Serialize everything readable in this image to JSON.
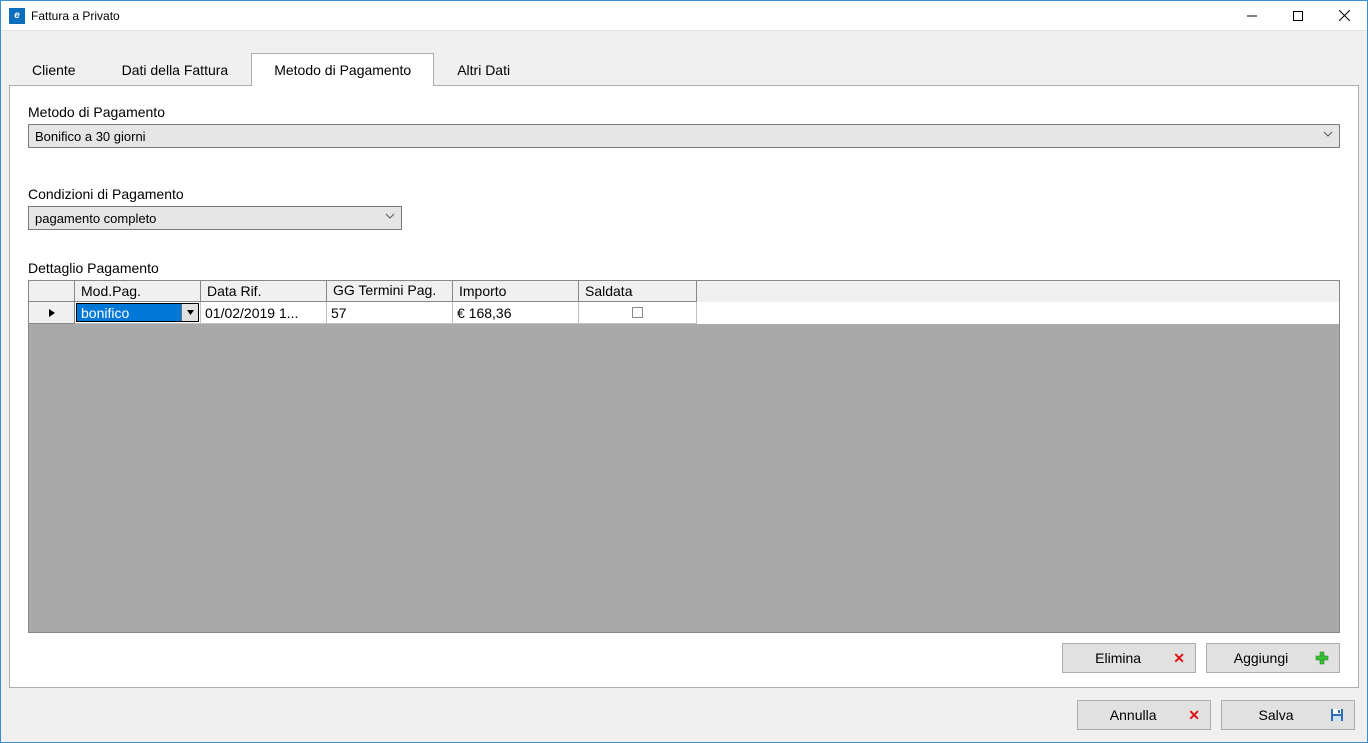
{
  "window": {
    "title": "Fattura a Privato",
    "icon_letter": "e"
  },
  "tabs": [
    {
      "label": "Cliente",
      "active": false
    },
    {
      "label": "Dati della Fattura",
      "active": false
    },
    {
      "label": "Metodo di Pagamento",
      "active": true
    },
    {
      "label": "Altri Dati",
      "active": false
    }
  ],
  "payment_method": {
    "label": "Metodo di Pagamento",
    "value": "Bonifico a 30 giorni"
  },
  "payment_conditions": {
    "label": "Condizioni di Pagamento",
    "value": "pagamento completo"
  },
  "detail": {
    "label": "Dettaglio Pagamento",
    "columns": {
      "mod_pag": "Mod.Pag.",
      "data_rif": "Data Rif.",
      "gg_termini": "GG Termini Pag.",
      "importo": "Importo",
      "saldata": "Saldata"
    },
    "rows": [
      {
        "mod_pag": "bonifico",
        "data_rif": "01/02/2019 1...",
        "gg_termini": "57",
        "importo": "€ 168,36",
        "saldata": false
      }
    ]
  },
  "buttons": {
    "elimina": "Elimina",
    "aggiungi": "Aggiungi",
    "annulla": "Annulla",
    "salva": "Salva"
  }
}
